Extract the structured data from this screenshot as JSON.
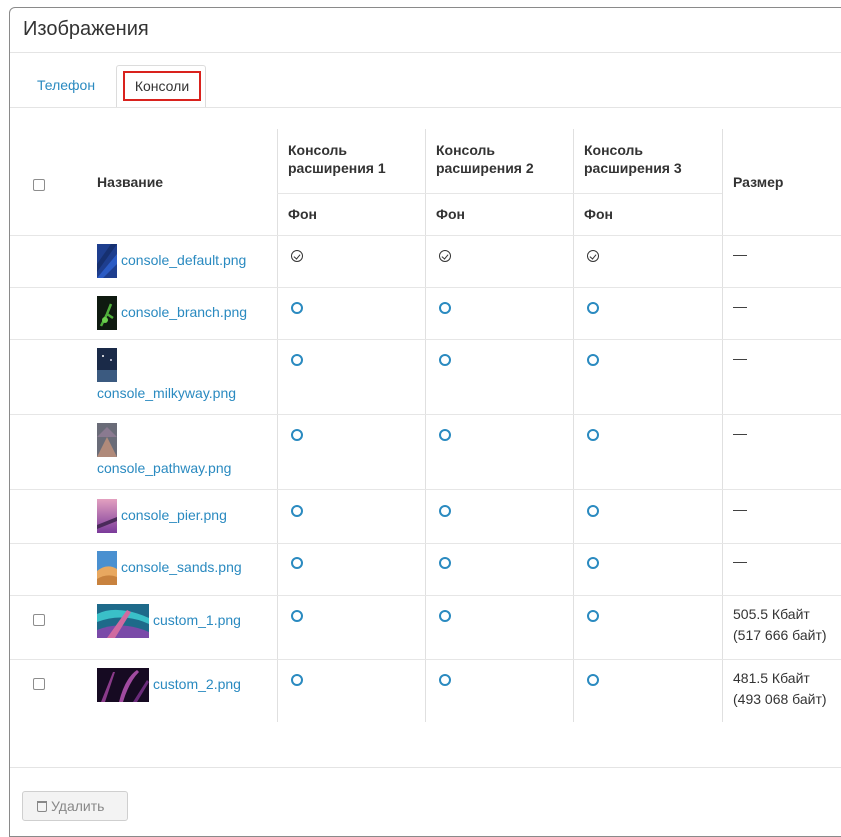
{
  "panel": {
    "title": "Изображения"
  },
  "tabs": [
    {
      "label": "Телефон",
      "active": false
    },
    {
      "label": "Консоли",
      "active": true
    }
  ],
  "table": {
    "headers": {
      "name": "Название",
      "console1": "Консоль расширения 1",
      "console2": "Консоль расширения 2",
      "console3": "Консоль расширения 3",
      "subheader": "Фон",
      "size": "Размер"
    },
    "rows": [
      {
        "name": "console_default.png",
        "checkbox": false,
        "selected": [
          true,
          true,
          true
        ],
        "size": "—"
      },
      {
        "name": "console_branch.png",
        "checkbox": false,
        "selected": [
          false,
          false,
          false
        ],
        "size": "—"
      },
      {
        "name": "console_milkyway.png",
        "checkbox": false,
        "selected": [
          false,
          false,
          false
        ],
        "size": "—"
      },
      {
        "name": "console_pathway.png",
        "checkbox": false,
        "selected": [
          false,
          false,
          false
        ],
        "size": "—"
      },
      {
        "name": "console_pier.png",
        "checkbox": false,
        "selected": [
          false,
          false,
          false
        ],
        "size": "—"
      },
      {
        "name": "console_sands.png",
        "checkbox": false,
        "selected": [
          false,
          false,
          false
        ],
        "size": "—"
      },
      {
        "name": "custom_1.png",
        "checkbox": true,
        "selected": [
          false,
          false,
          false
        ],
        "size_line1": "505.5 Кбайт",
        "size_line2": "(517 666 байт)"
      },
      {
        "name": "custom_2.png",
        "checkbox": true,
        "selected": [
          false,
          false,
          false
        ],
        "size_line1": "481.5 Кбайт",
        "size_line2": "(493 068 байт)"
      }
    ]
  },
  "actions": {
    "delete_label": "Удалить"
  },
  "colors": {
    "link": "#2a8ac0",
    "highlight_border": "#d9221d"
  }
}
